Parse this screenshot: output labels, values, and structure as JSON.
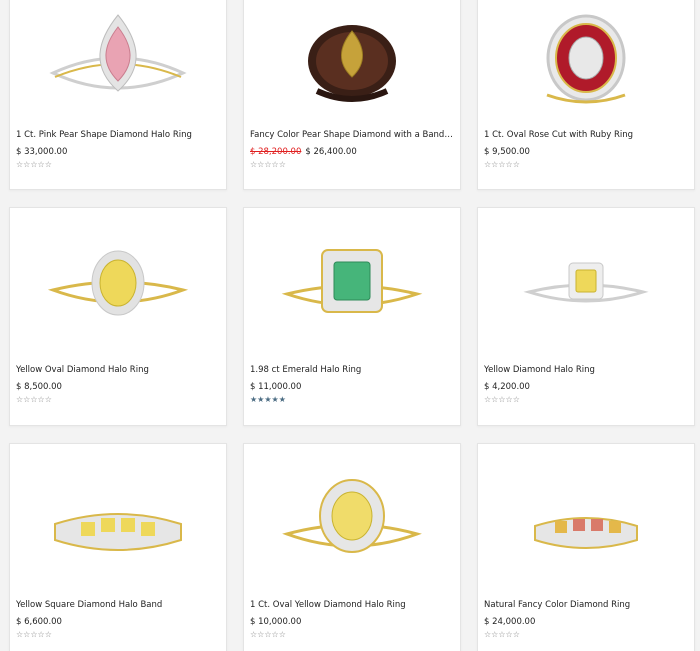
{
  "products": [
    {
      "title": "1 Ct. Pink Pear Shape Diamond Halo Ring",
      "price": "$ 33,000.00",
      "old_price": "",
      "rating": "☆☆☆☆☆",
      "stone_color": "#e9a3b3",
      "metal_color": "#d9b84a"
    },
    {
      "title": "Fancy Color Pear Shape Diamond with a Band of ...",
      "price": "$ 26,400.00",
      "old_price": "$ 28,200.00",
      "rating": "☆☆☆☆☆",
      "stone_color": "#c6a23a",
      "metal_color": "#4a2a1c"
    },
    {
      "title": "1 Ct. Oval Rose Cut with Ruby Ring",
      "price": "$ 9,500.00",
      "old_price": "",
      "rating": "☆☆☆☆☆",
      "stone_color": "#b01a2a",
      "metal_color": "#d9b84a"
    },
    {
      "title": "Yellow Oval Diamond Halo Ring",
      "price": "$ 8,500.00",
      "old_price": "",
      "rating": "☆☆☆☆☆",
      "stone_color": "#eed85a",
      "metal_color": "#d9b84a"
    },
    {
      "title": "1.98 ct Emerald Halo Ring",
      "price": "$ 11,000.00",
      "old_price": "",
      "rating": "★★★★★",
      "stone_color": "#46b57a",
      "metal_color": "#d9b84a"
    },
    {
      "title": "Yellow Diamond Halo Ring",
      "price": "$ 4,200.00",
      "old_price": "",
      "rating": "☆☆☆☆☆",
      "stone_color": "#eed85a",
      "metal_color": "#cfcfcf"
    },
    {
      "title": "Yellow Square Diamond Halo Band",
      "price": "$ 6,600.00",
      "old_price": "",
      "rating": "☆☆☆☆☆",
      "stone_color": "#eed85a",
      "metal_color": "#d9b84a"
    },
    {
      "title": "1 Ct. Oval Yellow Diamond Halo Ring",
      "price": "$ 10,000.00",
      "old_price": "",
      "rating": "☆☆☆☆☆",
      "stone_color": "#f0dc6a",
      "metal_color": "#d9b84a"
    },
    {
      "title": "Natural Fancy Color Diamond Ring",
      "price": "$ 24,000.00",
      "old_price": "",
      "rating": "☆☆☆☆☆",
      "stone_color": "#d97a6a",
      "metal_color": "#d9b84a"
    }
  ]
}
